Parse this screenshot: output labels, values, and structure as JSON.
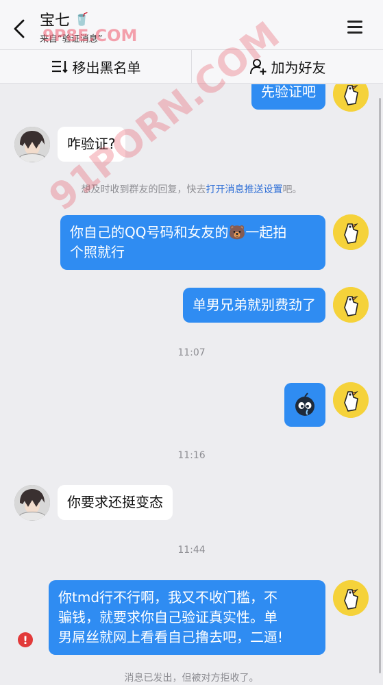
{
  "header": {
    "title": "宝七",
    "title_emoji": "🥤",
    "subtitle": "来自“验证消息”",
    "back_icon": "back-chevron-icon",
    "menu_icon": "hamburger-menu-icon"
  },
  "actions": {
    "remove_blacklist": "移出黑名单",
    "add_friend": "加为好友"
  },
  "messages": {
    "m1": "先验证吧",
    "m2": "咋验证?",
    "sys_prefix": "想及时收到群友的回复，快去",
    "sys_link": "打开消息推送设置",
    "sys_suffix": "吧。",
    "m3_line1": "你自己的QQ号码和女友的🐻一起拍",
    "m3_line2": "个照就行",
    "m4": "单男兄弟就别费劲了",
    "t1": "11:07",
    "t2": "11:16",
    "m6": "你要求还挺变态",
    "t3": "11:44",
    "m7_line1": "你tmd行不行啊，我又不收门槛，不",
    "m7_line2": "骗钱，就要求你自己验证真实性。单",
    "m7_line3": "男屌丝就网上看看自己撸去吧，二逼!",
    "sys_bottom": "消息已发出，但被对方拒收了。"
  },
  "watermark": {
    "text_top": "9P8E.COM",
    "text_diag": "91PORN.COM"
  },
  "colors": {
    "my_bubble": "#2f8cf2",
    "other_bubble": "#ffffff",
    "background": "#ededf0",
    "link": "#2f6fd6",
    "error": "#e23a3a"
  }
}
